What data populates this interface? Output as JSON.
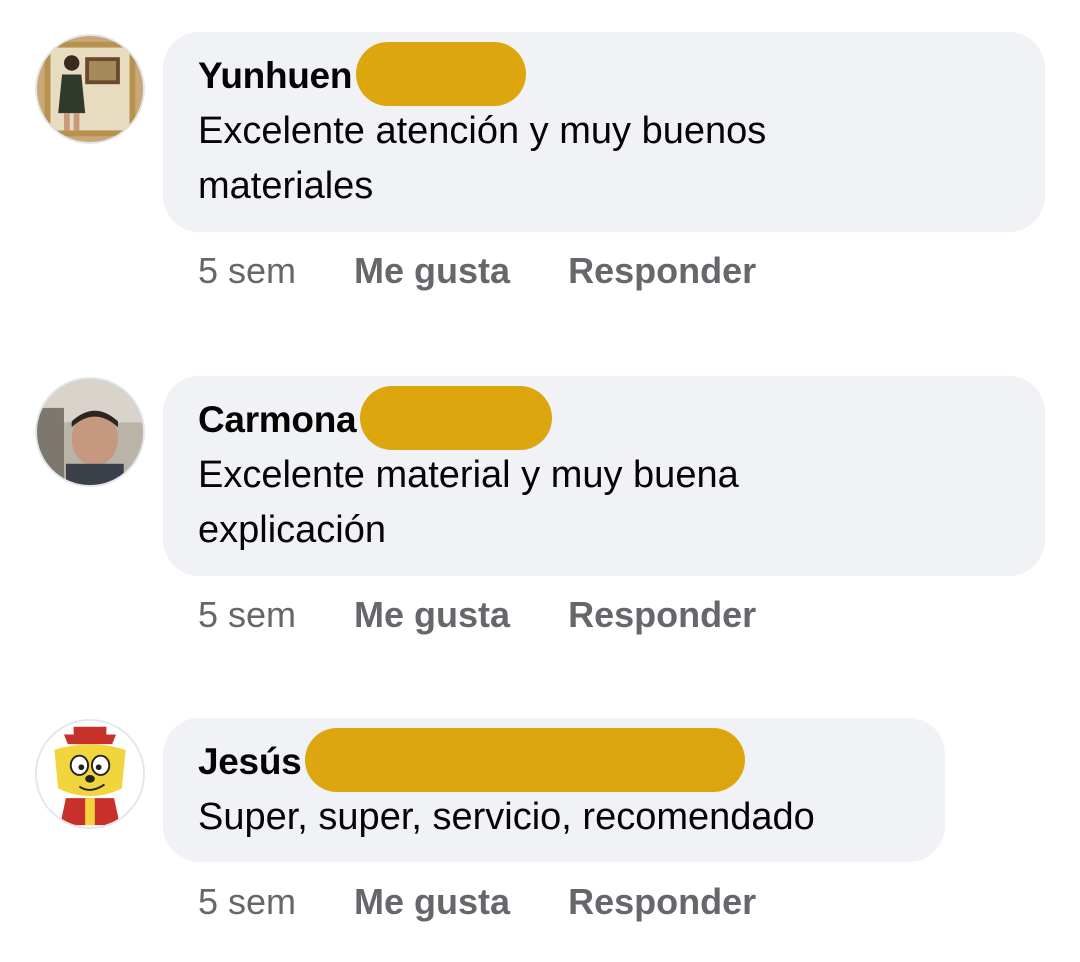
{
  "comments": [
    {
      "author": "Yunhuen",
      "text": "Excelente atención y muy buenos materiales",
      "time": "5 sem",
      "like_label": "Me gusta",
      "reply_label": "Responder",
      "avatar": "woman-mirror-selfie"
    },
    {
      "author": "Carmona",
      "text": "Excelente material y muy buena explicación",
      "time": "5 sem",
      "like_label": "Me gusta",
      "reply_label": "Responder",
      "avatar": "man-in-car"
    },
    {
      "author": "Jesús",
      "text": "Super, super, servicio, recomendado",
      "time": "5 sem",
      "like_label": "Me gusta",
      "reply_label": "Responder",
      "avatar": "cartoon-cat"
    }
  ],
  "colors": {
    "bubble": "#f0f2f5",
    "redaction": "#dea60e",
    "secondary_text": "#65676b",
    "primary_text": "#050505"
  }
}
